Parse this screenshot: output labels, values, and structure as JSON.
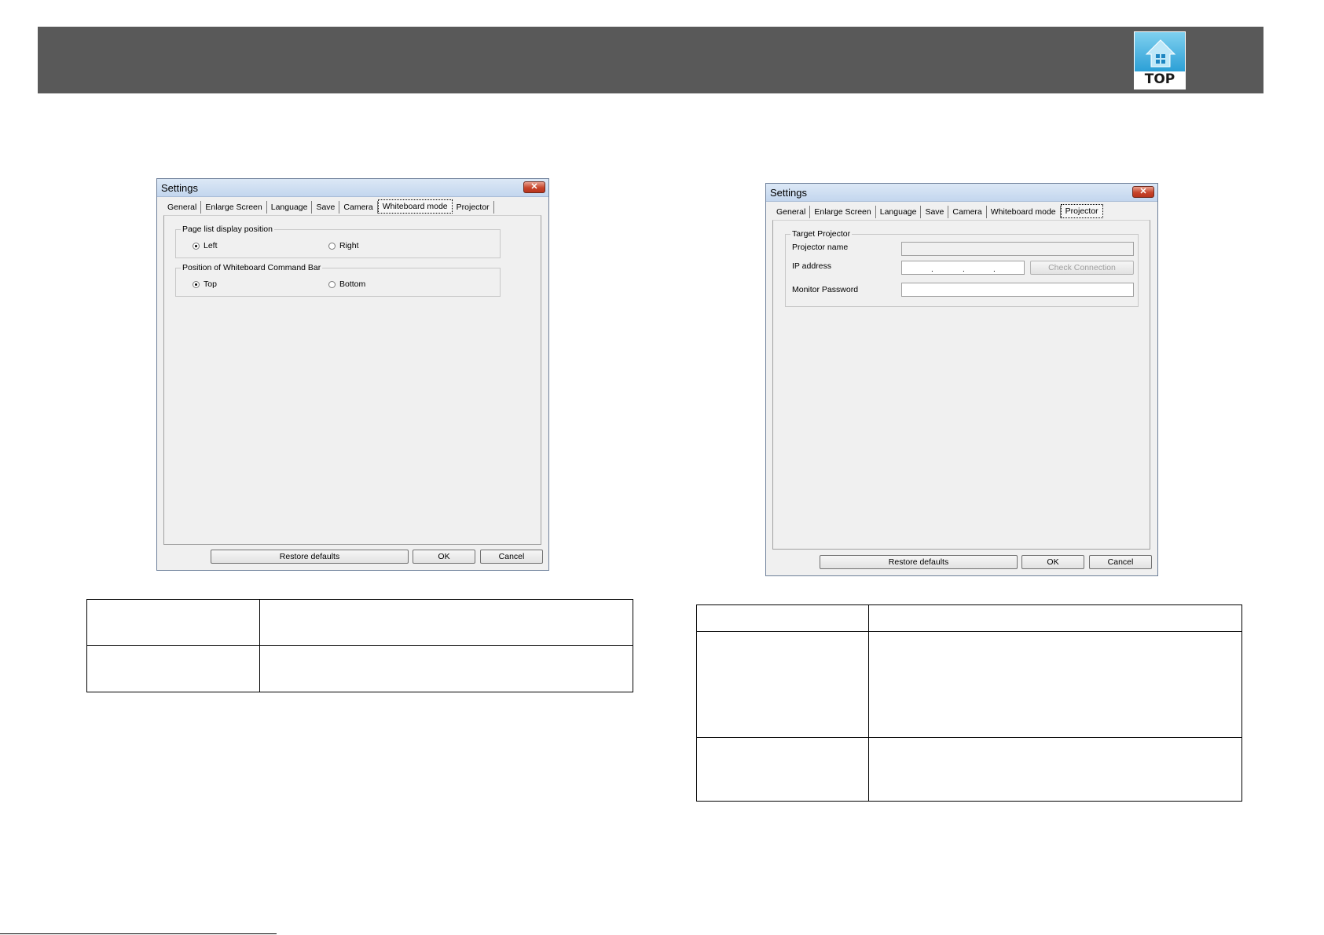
{
  "header": {
    "top_icon_label": "TOP"
  },
  "dialog_left": {
    "title": "Settings",
    "close_glyph": "✕",
    "tabs": [
      "General",
      "Enlarge Screen",
      "Language",
      "Save",
      "Camera",
      "Whiteboard mode",
      "Projector"
    ],
    "active_tab": "Whiteboard mode",
    "group_page_list": {
      "legend": "Page list display position",
      "option_left": "Left",
      "option_right": "Right",
      "selected": "Left"
    },
    "group_command_bar": {
      "legend": "Position of Whiteboard Command Bar",
      "option_top": "Top",
      "option_bottom": "Bottom",
      "selected": "Top"
    },
    "buttons": {
      "restore": "Restore defaults",
      "ok": "OK",
      "cancel": "Cancel"
    }
  },
  "dialog_right": {
    "title": "Settings",
    "close_glyph": "✕",
    "tabs": [
      "General",
      "Enlarge Screen",
      "Language",
      "Save",
      "Camera",
      "Whiteboard mode",
      "Projector"
    ],
    "active_tab": "Projector",
    "group_target": {
      "legend": "Target Projector",
      "projector_name_label": "Projector name",
      "ip_address_label": "IP address",
      "monitor_password_label": "Monitor Password",
      "check_connection": "Check Connection"
    },
    "buttons": {
      "restore": "Restore defaults",
      "ok": "OK",
      "cancel": "Cancel"
    }
  }
}
